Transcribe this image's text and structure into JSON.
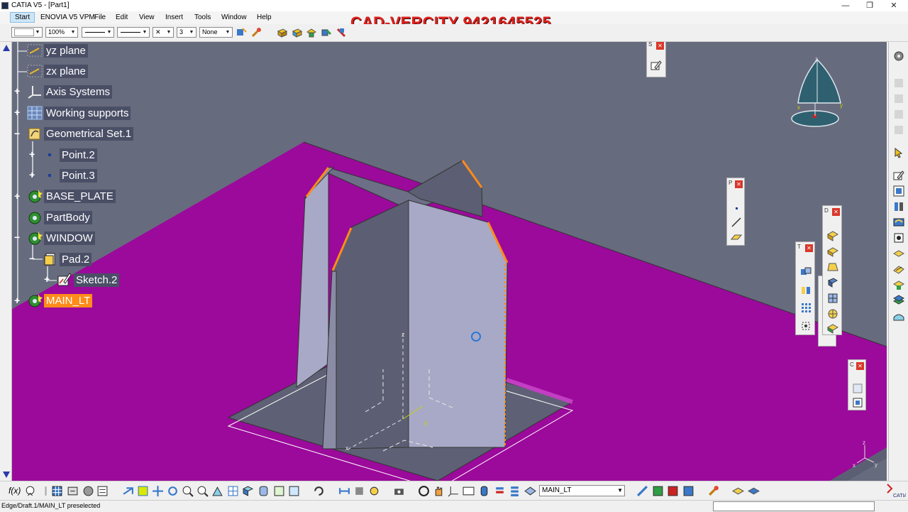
{
  "window": {
    "title": "CATIA V5 - [Part1]",
    "minimize": "—",
    "maximize": "❐",
    "close": "✕"
  },
  "menu": {
    "items": [
      "Start",
      "ENOVIA V5 VPM",
      "File",
      "Edit",
      "View",
      "Insert",
      "Tools",
      "Window",
      "Help"
    ]
  },
  "watermark": "CAD-VERCITY 9421645525",
  "toolbar": {
    "zoom_value": "100%",
    "thickness_value": "3",
    "layer_value": "None",
    "linetype_close": "✕"
  },
  "tree": {
    "items": [
      {
        "label": "yz plane",
        "icon": "plane-icon"
      },
      {
        "label": "zx plane",
        "icon": "plane-icon"
      },
      {
        "label": "Axis Systems",
        "icon": "axis-systems-icon"
      },
      {
        "label": "Working supports",
        "icon": "grid-icon"
      },
      {
        "label": "Geometrical Set.1",
        "icon": "geometrical-set-icon"
      },
      {
        "label": "Point.2",
        "icon": "point-icon"
      },
      {
        "label": "Point.3",
        "icon": "point-icon"
      },
      {
        "label": "BASE_PLATE",
        "icon": "body-gear-icon"
      },
      {
        "label": "PartBody",
        "icon": "body-gear-icon"
      },
      {
        "label": "WINDOW",
        "icon": "body-gear-icon"
      },
      {
        "label": "Pad.2",
        "icon": "pad-icon"
      },
      {
        "label": "Sketch.2",
        "icon": "sketch-icon"
      },
      {
        "label": "MAIN_LT",
        "icon": "body-gear-icon",
        "selected": true
      }
    ]
  },
  "floating_toolbars": {
    "sketcher_title": "S",
    "points_title": "P",
    "tools_title": "T",
    "dress_title": "D",
    "c_title": "C",
    "close_glyph": "✕"
  },
  "compass_axes": {
    "z": "z",
    "x": "x",
    "y": "y"
  },
  "triad_axes": {
    "z": "z",
    "x": "x",
    "y": "y"
  },
  "sketch_axes": {
    "z": "z",
    "x": "x",
    "y": "y"
  },
  "bottom": {
    "current_body": "MAIN_LT",
    "formula_label": "f(x)"
  },
  "status": {
    "text": "Edge/Draft.1/MAIN_LT preselected"
  },
  "colors": {
    "background": "#676b7e",
    "plate": "#9b0a9b",
    "solid_light": "#a7a9c6",
    "solid_dark": "#5c5f73",
    "highlight_edge": "#ff8c1a",
    "tree_label_bg": "#4a4f66",
    "watermark": "#e0201c"
  }
}
